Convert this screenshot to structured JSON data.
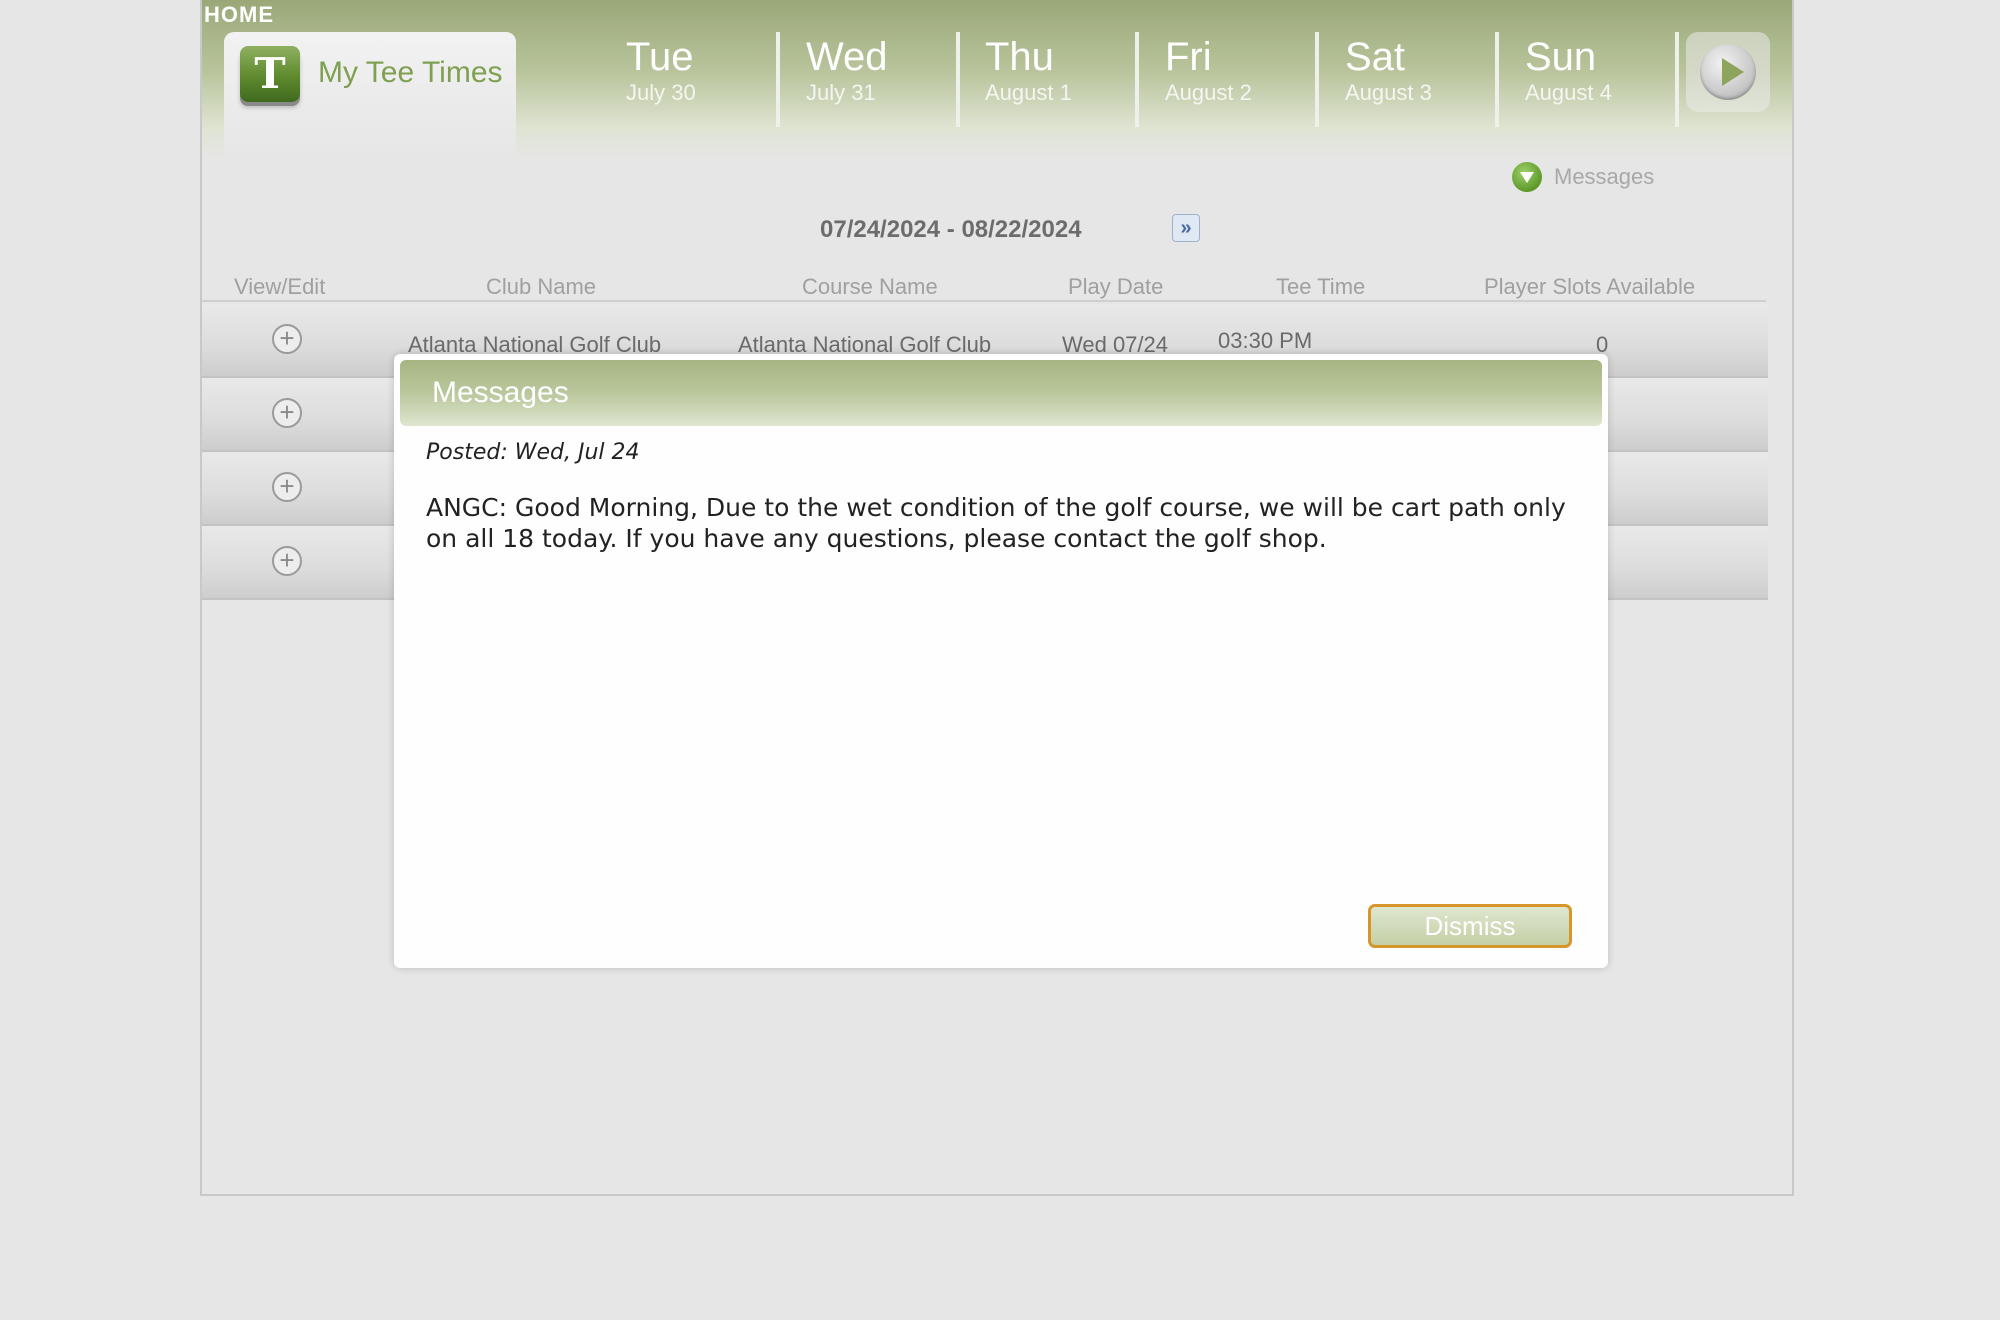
{
  "header": {
    "home_label": "HOME",
    "active_tab": {
      "label": "My Tee Times",
      "icon_letter": "T"
    },
    "days": [
      {
        "name": "Tue",
        "date": "July 30"
      },
      {
        "name": "Wed",
        "date": "July 31"
      },
      {
        "name": "Thu",
        "date": "August 1"
      },
      {
        "name": "Fri",
        "date": "August 2"
      },
      {
        "name": "Sat",
        "date": "August 3"
      },
      {
        "name": "Sun",
        "date": "August 4"
      }
    ]
  },
  "messages_link": "Messages",
  "date_range": {
    "label": "07/24/2024 - 08/22/2024",
    "next_glyph": "»"
  },
  "table": {
    "columns": [
      "View/Edit",
      "Club Name",
      "Course Name",
      "Play Date",
      "Tee Time",
      "Player Slots Available"
    ],
    "rows": [
      {
        "club": "Atlanta National Golf Club",
        "course": "Atlanta National Golf Club",
        "play_date": "Wed 07/24",
        "tee_time": "03:30 PM",
        "slots": "0"
      },
      {
        "club": "",
        "course": "",
        "play_date": "",
        "tee_time": "",
        "slots": ""
      },
      {
        "club": "",
        "course": "",
        "play_date": "",
        "tee_time": "",
        "slots": ""
      },
      {
        "club": "",
        "course": "",
        "play_date": "",
        "tee_time": "",
        "slots": ""
      }
    ],
    "expand_glyph": "+"
  },
  "modal": {
    "title": "Messages",
    "posted": "Posted: Wed, Jul 24",
    "body": "ANGC: Good Morning, Due to the wet condition of the golf course, we will be cart path only on all 18 today. If you have any questions, please contact the golf shop.",
    "dismiss_label": "Dismiss"
  },
  "colors": {
    "header_green": "#9aa878",
    "accent_green": "#7fa050",
    "dismiss_border": "#d6962a"
  }
}
